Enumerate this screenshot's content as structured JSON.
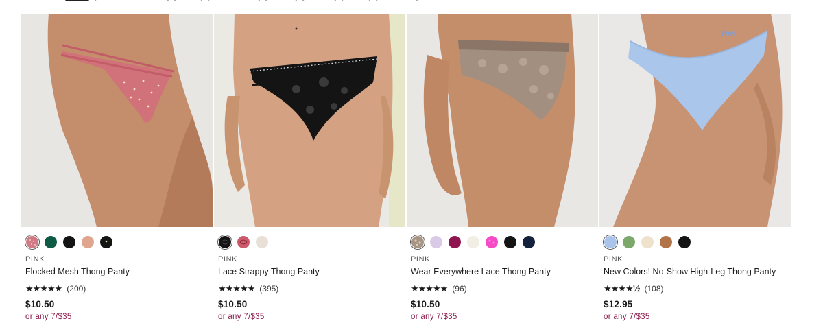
{
  "products": [
    {
      "brand": "PINK",
      "name": "Flocked Mesh Thong Panty",
      "stars": "★★★★★",
      "reviews": "(200)",
      "price": "$10.50",
      "promo": "or any 7/$35",
      "swatches": [
        "#d17a86",
        "#0f5a45",
        "#141414",
        "#e0a58f",
        "#141414"
      ]
    },
    {
      "brand": "PINK",
      "name": "Lace Strappy Thong Panty",
      "stars": "★★★★★",
      "reviews": "(395)",
      "price": "$10.50",
      "promo": "or any 7/$35",
      "swatches": [
        "#141414",
        "#cc5a6b",
        "#e8e0d6"
      ]
    },
    {
      "brand": "PINK",
      "name": "Wear Everywhere Lace Thong Panty",
      "stars": "★★★★★",
      "reviews": "(96)",
      "price": "$10.50",
      "promo": "or any 7/$35",
      "swatches": [
        "#a69583",
        "#d9cbe6",
        "#8f1550",
        "#f1eee5",
        "#f44bc7",
        "#141414",
        "#14213d"
      ]
    },
    {
      "brand": "PINK",
      "name": "New Colors! No-Show High-Leg Thong Panty",
      "stars": "★★★★½",
      "reviews": "(108)",
      "price": "$12.95",
      "promo": "or any 7/$35",
      "swatches": [
        "#a9c3ea",
        "#7ca86a",
        "#efe2cd",
        "#b07448",
        "#141414"
      ]
    }
  ],
  "colors": {
    "promo": "#8a1b4c",
    "skin": "#c99270",
    "background_photo": "#e9e7e4"
  }
}
